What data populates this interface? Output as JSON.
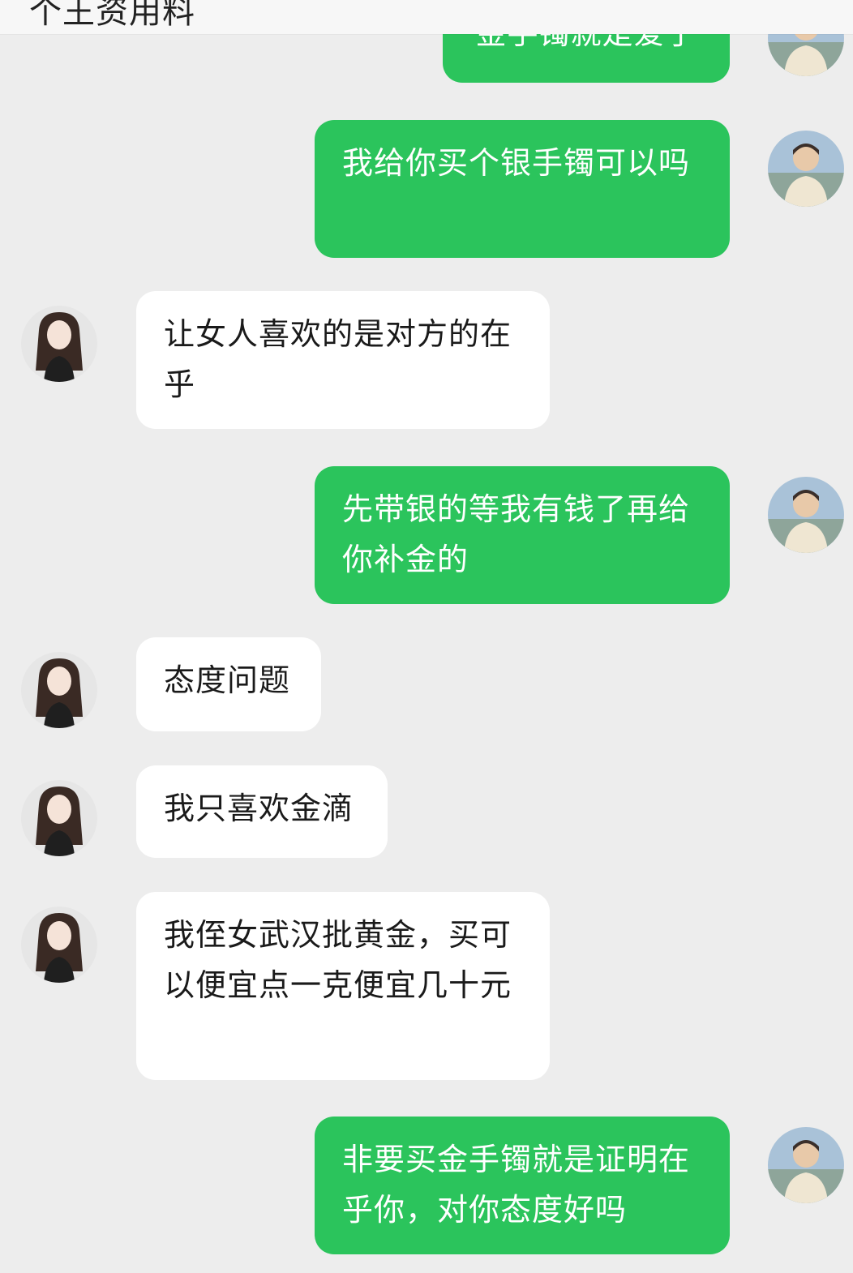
{
  "header": {
    "title": "个王资用料"
  },
  "messages": [
    {
      "side": "out",
      "text": "金手镯就是爱了"
    },
    {
      "side": "out",
      "text": "我给你买个银手镯可以吗"
    },
    {
      "side": "in",
      "text": "让女人喜欢的是对方的在乎"
    },
    {
      "side": "out",
      "text": "先带银的等我有钱了再给你补金的"
    },
    {
      "side": "in",
      "text": "态度问题"
    },
    {
      "side": "in",
      "text": "我只喜欢金滴"
    },
    {
      "side": "in",
      "text": "我侄女武汉批黄金，买可以便宜点一克便宜几十元"
    },
    {
      "side": "out",
      "text": "非要买金手镯就是证明在乎你，对你态度好吗"
    }
  ],
  "colors": {
    "outgoing_bubble": "#2bc45c",
    "incoming_bubble": "#ffffff",
    "background": "#ededed"
  }
}
